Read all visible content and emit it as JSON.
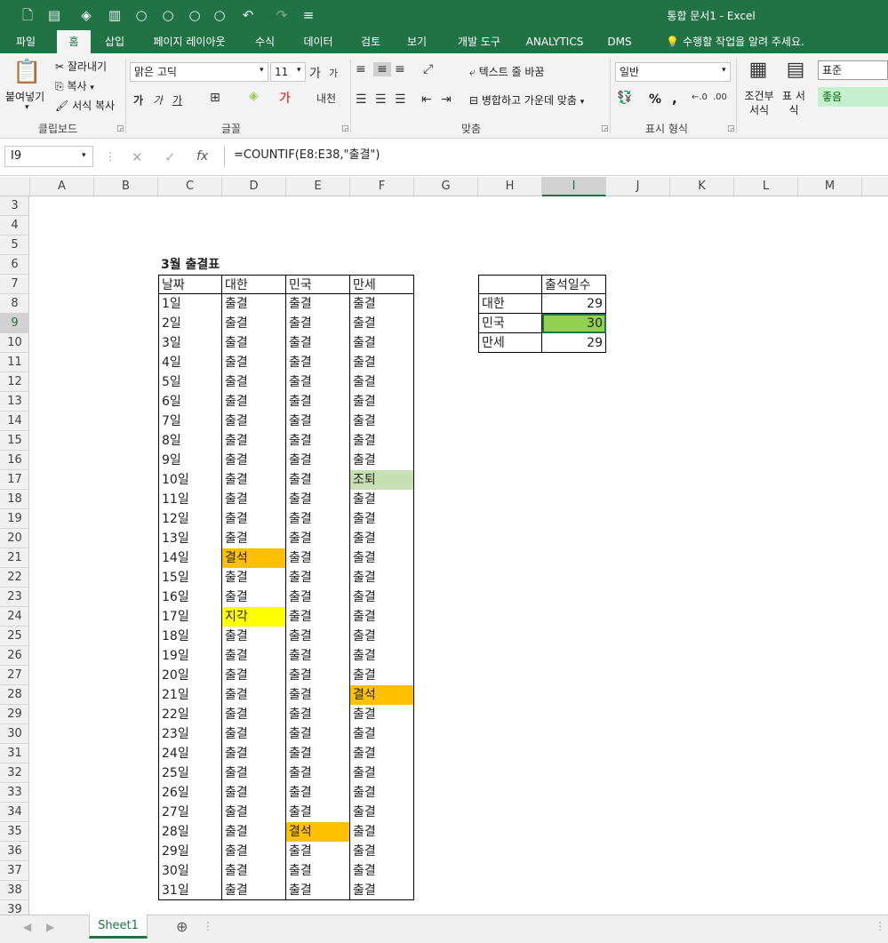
{
  "app": {
    "window_title": "통합 문서1 - Excel",
    "quick_access": [
      "save-icon",
      "form-icon",
      "fill-icon",
      "format-icon",
      "circle-icon",
      "circle-icon",
      "circle-icon",
      "circle-icon",
      "undo-icon",
      "redo-icon",
      "customize-icon"
    ]
  },
  "tabs": [
    "파일",
    "홈",
    "삽입",
    "페이지 레이아웃",
    "수식",
    "데이터",
    "검토",
    "보기",
    "개발 도구",
    "ANALYTICS",
    "DMS",
    "수행할 작업을 알려 주세요."
  ],
  "active_tab": "홈",
  "ribbon": {
    "clipboard": {
      "paste": "붙여넣기",
      "cut": "잘라내기",
      "copy": "복사",
      "format_painter": "서식 복사",
      "group": "클립보드"
    },
    "font": {
      "name": "맑은 고딕",
      "size": "11",
      "group": "글꼴"
    },
    "alignment": {
      "wrap": "텍스트 줄 바꿈",
      "merge": "병합하고 가운데 맞춤",
      "group": "맞춤"
    },
    "number": {
      "format": "일반",
      "percent": "%",
      "comma": ",",
      "group": "표시 형식"
    },
    "styles": {
      "conditional": "조건부 서식",
      "table": "표 서식",
      "normal": "표준",
      "good": "좋음"
    }
  },
  "formula_bar": {
    "name_box": "I9",
    "formula": "=COUNTIF(E8:E38,\"출결\")"
  },
  "columns": [
    "A",
    "B",
    "C",
    "D",
    "E",
    "F",
    "G",
    "H",
    "I",
    "J",
    "K",
    "L",
    "M"
  ],
  "selected_column": "I",
  "rows": [
    3,
    4,
    5,
    6,
    7,
    8,
    9,
    10,
    11,
    12,
    13,
    14,
    15,
    16,
    17,
    18,
    19,
    20,
    21,
    22,
    23,
    24,
    25,
    26,
    27,
    28,
    29,
    30,
    31,
    32,
    33,
    34,
    35,
    36,
    37,
    38,
    39
  ],
  "selected_row": 9,
  "table_title": "3월 출결표",
  "attendance_headers": [
    "날짜",
    "대한",
    "민국",
    "만세"
  ],
  "attendance": [
    [
      "1일",
      "출결",
      "출결",
      "출결"
    ],
    [
      "2일",
      "출결",
      "출결",
      "출결"
    ],
    [
      "3일",
      "출결",
      "출결",
      "출결"
    ],
    [
      "4일",
      "출결",
      "출결",
      "출결"
    ],
    [
      "5일",
      "출결",
      "출결",
      "출결"
    ],
    [
      "6일",
      "출결",
      "출결",
      "출결"
    ],
    [
      "7일",
      "출결",
      "출결",
      "출결"
    ],
    [
      "8일",
      "출결",
      "출결",
      "출결"
    ],
    [
      "9일",
      "출결",
      "출결",
      "출결"
    ],
    [
      "10일",
      "출결",
      "출결",
      "조퇴"
    ],
    [
      "11일",
      "출결",
      "출결",
      "출결"
    ],
    [
      "12일",
      "출결",
      "출결",
      "출결"
    ],
    [
      "13일",
      "출결",
      "출결",
      "출결"
    ],
    [
      "14일",
      "결석",
      "출결",
      "출결"
    ],
    [
      "15일",
      "출결",
      "출결",
      "출결"
    ],
    [
      "16일",
      "출결",
      "출결",
      "출결"
    ],
    [
      "17일",
      "지각",
      "출결",
      "출결"
    ],
    [
      "18일",
      "출결",
      "출결",
      "출결"
    ],
    [
      "19일",
      "출결",
      "출결",
      "출결"
    ],
    [
      "20일",
      "출결",
      "출결",
      "출결"
    ],
    [
      "21일",
      "출결",
      "출결",
      "결석"
    ],
    [
      "22일",
      "출결",
      "출결",
      "출결"
    ],
    [
      "23일",
      "출결",
      "출결",
      "출결"
    ],
    [
      "24일",
      "출결",
      "출결",
      "출결"
    ],
    [
      "25일",
      "출결",
      "출결",
      "출결"
    ],
    [
      "26일",
      "출결",
      "출결",
      "출결"
    ],
    [
      "27일",
      "출결",
      "출결",
      "출결"
    ],
    [
      "28일",
      "출결",
      "결석",
      "출결"
    ],
    [
      "29일",
      "출결",
      "출결",
      "출결"
    ],
    [
      "30일",
      "출결",
      "출결",
      "출결"
    ],
    [
      "31일",
      "출결",
      "출결",
      "출결"
    ]
  ],
  "highlight_colors": {
    "결석": "#FFC000",
    "지각": "#FFFF00",
    "조퇴": "#C6E0B4",
    "selected": "#92D050"
  },
  "summary": {
    "header": "출석일수",
    "rows": [
      [
        "대한",
        "29"
      ],
      [
        "민국",
        "30"
      ],
      [
        "만세",
        "29"
      ]
    ]
  },
  "sheet_tab": "Sheet1"
}
